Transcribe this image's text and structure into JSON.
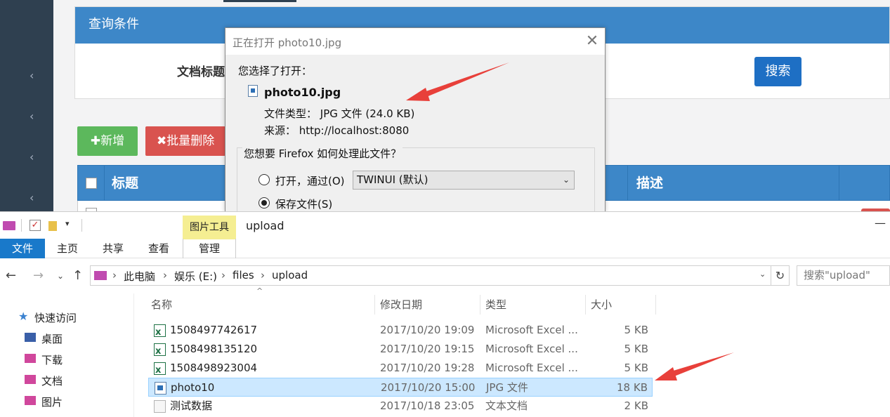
{
  "colors": {
    "primary_blue": "#3d87c8",
    "sidebar": "#2f4050",
    "success": "#5cb85c",
    "danger": "#d9534f",
    "file_tab": "#1979ca",
    "selection": "#cce8ff",
    "arrow": "#e8403a"
  },
  "web": {
    "query_panel_title": "查询条件",
    "query_label": "文档标题",
    "search_button": "搜索",
    "add_button": "✚新增",
    "batch_delete_button": "✖批量删除",
    "table_headers": {
      "title": "标题",
      "description": "描述"
    }
  },
  "dialog": {
    "title": "正在打开 photo10.jpg",
    "you_chose": "您选择了打开：",
    "filename": "photo10.jpg",
    "file_type_line": "文件类型： JPG 文件 (24.0 KB)",
    "source_line": "来源： http://localhost:8080",
    "question": "您想要 Firefox 如何处理此文件？",
    "open_with_label": "打开，通过(O)",
    "open_with_value": "TWINUI (默认)",
    "save_file_label": "保存文件(S)"
  },
  "explorer": {
    "context_tab": "图片工具",
    "window_title": "upload",
    "ribbon_tabs": [
      "文件",
      "主页",
      "共享",
      "查看",
      "管理"
    ],
    "breadcrumbs": [
      "此电脑",
      "娱乐 (E:)",
      "files",
      "upload"
    ],
    "search_placeholder": "搜索\"upload\"",
    "nav_items": [
      "快速访问",
      "桌面",
      "下载",
      "文档",
      "图片"
    ],
    "columns": [
      "名称",
      "修改日期",
      "类型",
      "大小"
    ],
    "files": [
      {
        "name": "1508497742617",
        "date": "2017/10/20 19:09",
        "type": "Microsoft Excel ...",
        "size": "5 KB",
        "icon": "excel-file-icon"
      },
      {
        "name": "1508498135120",
        "date": "2017/10/20 19:15",
        "type": "Microsoft Excel ...",
        "size": "5 KB",
        "icon": "excel-file-icon"
      },
      {
        "name": "1508498923004",
        "date": "2017/10/20 19:28",
        "type": "Microsoft Excel ...",
        "size": "5 KB",
        "icon": "excel-file-icon"
      },
      {
        "name": "photo10",
        "date": "2017/10/20 15:00",
        "type": "JPG 文件",
        "size": "18 KB",
        "icon": "jpg-file-icon",
        "selected": true
      },
      {
        "name": "测试数据",
        "date": "2017/10/18 23:05",
        "type": "文本文档",
        "size": "2 KB",
        "icon": "text-file-icon"
      }
    ]
  }
}
